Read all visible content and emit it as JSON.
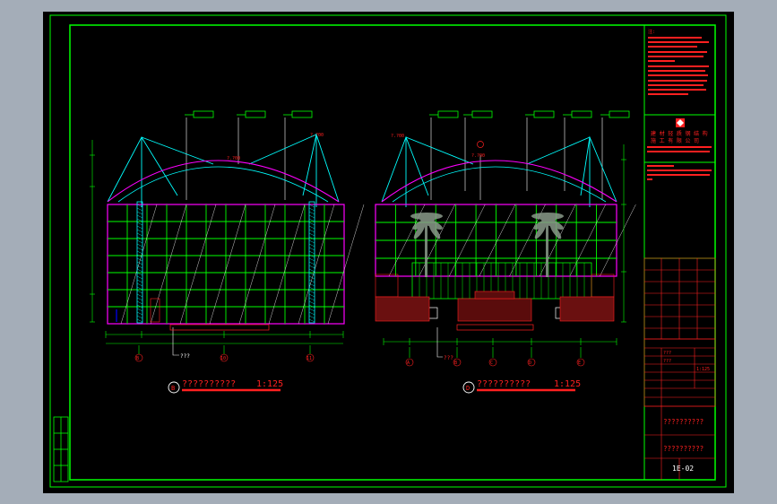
{
  "sheet": {
    "background": "#000000",
    "frame_color": "#00ff00",
    "accent_red": "#ff2020",
    "line_cyan": "#00ffff",
    "line_magenta": "#ff00ff",
    "line_white": "#ffffff"
  },
  "left_elevation": {
    "title": "??????????",
    "scale": "1:125",
    "marker": "B",
    "grid_labels": [
      "B",
      "10",
      "11"
    ],
    "bottom_note": "???",
    "elevation_tag": "?.?00"
  },
  "right_elevation": {
    "title": "??????????",
    "scale": "1:125",
    "marker": "D",
    "grid_labels": [
      "A",
      "B",
      "C",
      "D",
      "E"
    ],
    "bottom_note": "???",
    "elevation_tag": "?.?00"
  },
  "title_block": {
    "notes_heading": "注:",
    "company": [
      "建 材 轻 质 钢 结 构",
      "施 工 有 限 公 司"
    ],
    "drawing_title_1": "??????????",
    "drawing_title_2": "??????????",
    "drawing_number": "1E-02",
    "row_labels": [
      "???",
      "???",
      "1:125"
    ]
  }
}
